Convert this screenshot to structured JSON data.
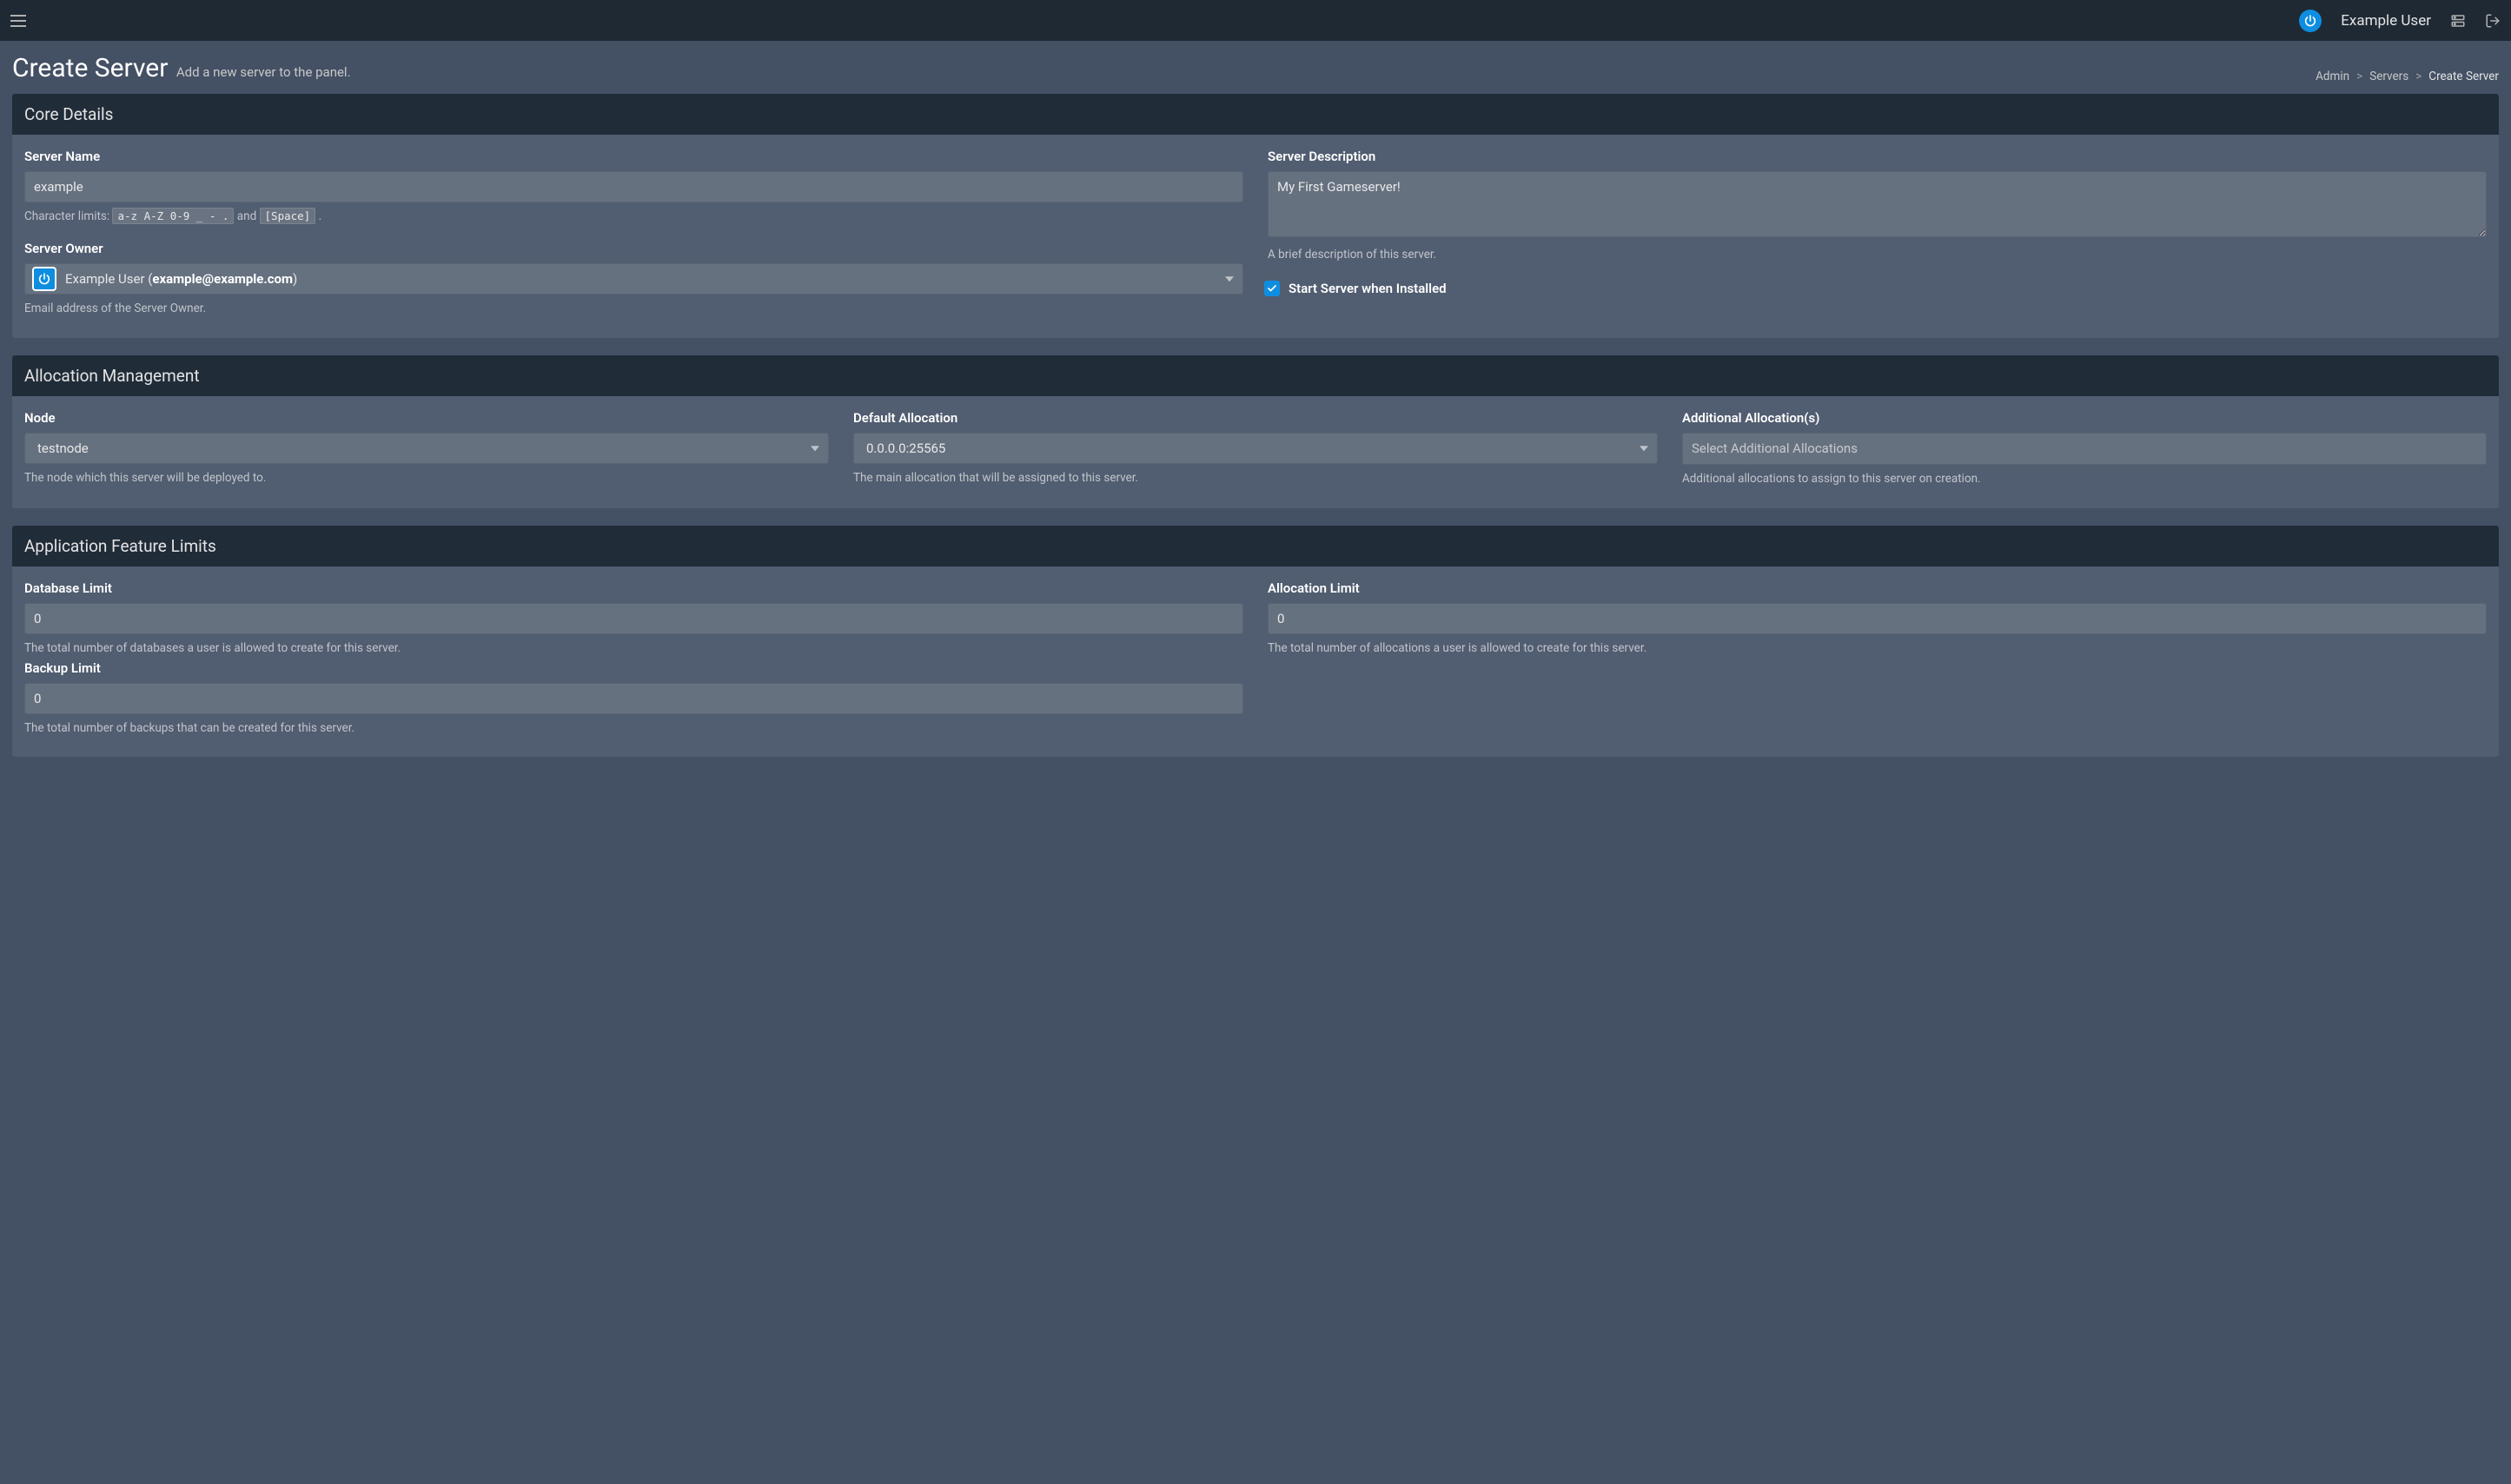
{
  "topnav": {
    "user_name": "Example User"
  },
  "page": {
    "title": "Create Server",
    "subtitle": "Add a new server to the panel."
  },
  "breadcrumb": {
    "admin": "Admin",
    "servers": "Servers",
    "current": "Create Server"
  },
  "panels": {
    "core": {
      "title": "Core Details",
      "server_name": {
        "label": "Server Name",
        "value": "example",
        "help_prefix": "Character limits: ",
        "help_code1": "a-z A-Z 0-9 _ - .",
        "help_and": " and ",
        "help_code2": "[Space]",
        "help_suffix": " ."
      },
      "server_owner": {
        "label": "Server Owner",
        "value_prefix": "Example User (",
        "value_email": "example@example.com",
        "value_suffix": ")",
        "help": "Email address of the Server Owner."
      },
      "server_desc": {
        "label": "Server Description",
        "value": "My First Gameserver!",
        "help": "A brief description of this server."
      },
      "start_when_installed": {
        "checked": true,
        "label": "Start Server when Installed"
      }
    },
    "alloc": {
      "title": "Allocation Management",
      "node": {
        "label": "Node",
        "value": "testnode",
        "help": "The node which this server will be deployed to."
      },
      "default_alloc": {
        "label": "Default Allocation",
        "value": "0.0.0.0:25565",
        "help": "The main allocation that will be assigned to this server."
      },
      "additional_alloc": {
        "label": "Additional Allocation(s)",
        "placeholder": "Select Additional Allocations",
        "help": "Additional allocations to assign to this server on creation."
      }
    },
    "limits": {
      "title": "Application Feature Limits",
      "db": {
        "label": "Database Limit",
        "value": "0",
        "help": "The total number of databases a user is allowed to create for this server."
      },
      "alloc": {
        "label": "Allocation Limit",
        "value": "0",
        "help": "The total number of allocations a user is allowed to create for this server."
      },
      "backup": {
        "label": "Backup Limit",
        "value": "0",
        "help": "The total number of backups that can be created for this server."
      }
    }
  }
}
